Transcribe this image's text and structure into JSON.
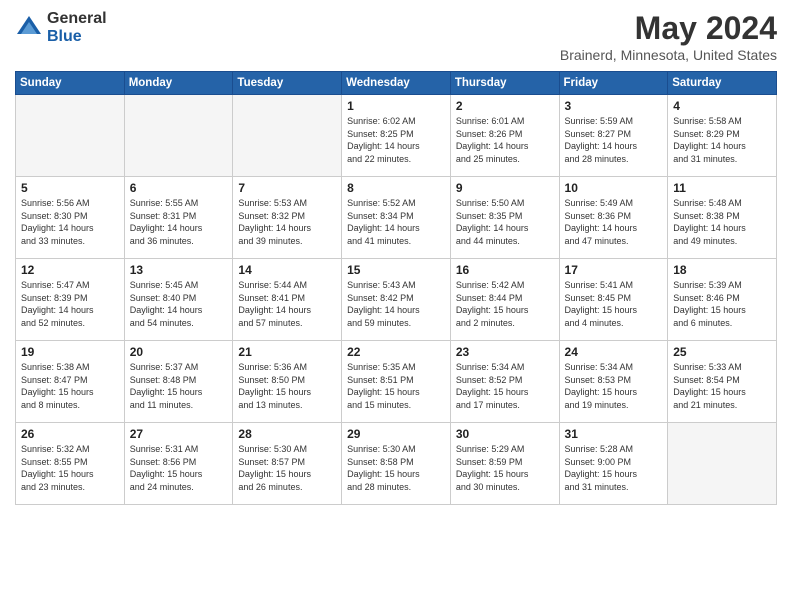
{
  "logo": {
    "general": "General",
    "blue": "Blue"
  },
  "title": "May 2024",
  "subtitle": "Brainerd, Minnesota, United States",
  "headers": [
    "Sunday",
    "Monday",
    "Tuesday",
    "Wednesday",
    "Thursday",
    "Friday",
    "Saturday"
  ],
  "weeks": [
    [
      {
        "day": "",
        "info": ""
      },
      {
        "day": "",
        "info": ""
      },
      {
        "day": "",
        "info": ""
      },
      {
        "day": "1",
        "info": "Sunrise: 6:02 AM\nSunset: 8:25 PM\nDaylight: 14 hours\nand 22 minutes."
      },
      {
        "day": "2",
        "info": "Sunrise: 6:01 AM\nSunset: 8:26 PM\nDaylight: 14 hours\nand 25 minutes."
      },
      {
        "day": "3",
        "info": "Sunrise: 5:59 AM\nSunset: 8:27 PM\nDaylight: 14 hours\nand 28 minutes."
      },
      {
        "day": "4",
        "info": "Sunrise: 5:58 AM\nSunset: 8:29 PM\nDaylight: 14 hours\nand 31 minutes."
      }
    ],
    [
      {
        "day": "5",
        "info": "Sunrise: 5:56 AM\nSunset: 8:30 PM\nDaylight: 14 hours\nand 33 minutes."
      },
      {
        "day": "6",
        "info": "Sunrise: 5:55 AM\nSunset: 8:31 PM\nDaylight: 14 hours\nand 36 minutes."
      },
      {
        "day": "7",
        "info": "Sunrise: 5:53 AM\nSunset: 8:32 PM\nDaylight: 14 hours\nand 39 minutes."
      },
      {
        "day": "8",
        "info": "Sunrise: 5:52 AM\nSunset: 8:34 PM\nDaylight: 14 hours\nand 41 minutes."
      },
      {
        "day": "9",
        "info": "Sunrise: 5:50 AM\nSunset: 8:35 PM\nDaylight: 14 hours\nand 44 minutes."
      },
      {
        "day": "10",
        "info": "Sunrise: 5:49 AM\nSunset: 8:36 PM\nDaylight: 14 hours\nand 47 minutes."
      },
      {
        "day": "11",
        "info": "Sunrise: 5:48 AM\nSunset: 8:38 PM\nDaylight: 14 hours\nand 49 minutes."
      }
    ],
    [
      {
        "day": "12",
        "info": "Sunrise: 5:47 AM\nSunset: 8:39 PM\nDaylight: 14 hours\nand 52 minutes."
      },
      {
        "day": "13",
        "info": "Sunrise: 5:45 AM\nSunset: 8:40 PM\nDaylight: 14 hours\nand 54 minutes."
      },
      {
        "day": "14",
        "info": "Sunrise: 5:44 AM\nSunset: 8:41 PM\nDaylight: 14 hours\nand 57 minutes."
      },
      {
        "day": "15",
        "info": "Sunrise: 5:43 AM\nSunset: 8:42 PM\nDaylight: 14 hours\nand 59 minutes."
      },
      {
        "day": "16",
        "info": "Sunrise: 5:42 AM\nSunset: 8:44 PM\nDaylight: 15 hours\nand 2 minutes."
      },
      {
        "day": "17",
        "info": "Sunrise: 5:41 AM\nSunset: 8:45 PM\nDaylight: 15 hours\nand 4 minutes."
      },
      {
        "day": "18",
        "info": "Sunrise: 5:39 AM\nSunset: 8:46 PM\nDaylight: 15 hours\nand 6 minutes."
      }
    ],
    [
      {
        "day": "19",
        "info": "Sunrise: 5:38 AM\nSunset: 8:47 PM\nDaylight: 15 hours\nand 8 minutes."
      },
      {
        "day": "20",
        "info": "Sunrise: 5:37 AM\nSunset: 8:48 PM\nDaylight: 15 hours\nand 11 minutes."
      },
      {
        "day": "21",
        "info": "Sunrise: 5:36 AM\nSunset: 8:50 PM\nDaylight: 15 hours\nand 13 minutes."
      },
      {
        "day": "22",
        "info": "Sunrise: 5:35 AM\nSunset: 8:51 PM\nDaylight: 15 hours\nand 15 minutes."
      },
      {
        "day": "23",
        "info": "Sunrise: 5:34 AM\nSunset: 8:52 PM\nDaylight: 15 hours\nand 17 minutes."
      },
      {
        "day": "24",
        "info": "Sunrise: 5:34 AM\nSunset: 8:53 PM\nDaylight: 15 hours\nand 19 minutes."
      },
      {
        "day": "25",
        "info": "Sunrise: 5:33 AM\nSunset: 8:54 PM\nDaylight: 15 hours\nand 21 minutes."
      }
    ],
    [
      {
        "day": "26",
        "info": "Sunrise: 5:32 AM\nSunset: 8:55 PM\nDaylight: 15 hours\nand 23 minutes."
      },
      {
        "day": "27",
        "info": "Sunrise: 5:31 AM\nSunset: 8:56 PM\nDaylight: 15 hours\nand 24 minutes."
      },
      {
        "day": "28",
        "info": "Sunrise: 5:30 AM\nSunset: 8:57 PM\nDaylight: 15 hours\nand 26 minutes."
      },
      {
        "day": "29",
        "info": "Sunrise: 5:30 AM\nSunset: 8:58 PM\nDaylight: 15 hours\nand 28 minutes."
      },
      {
        "day": "30",
        "info": "Sunrise: 5:29 AM\nSunset: 8:59 PM\nDaylight: 15 hours\nand 30 minutes."
      },
      {
        "day": "31",
        "info": "Sunrise: 5:28 AM\nSunset: 9:00 PM\nDaylight: 15 hours\nand 31 minutes."
      },
      {
        "day": "",
        "info": ""
      }
    ]
  ]
}
